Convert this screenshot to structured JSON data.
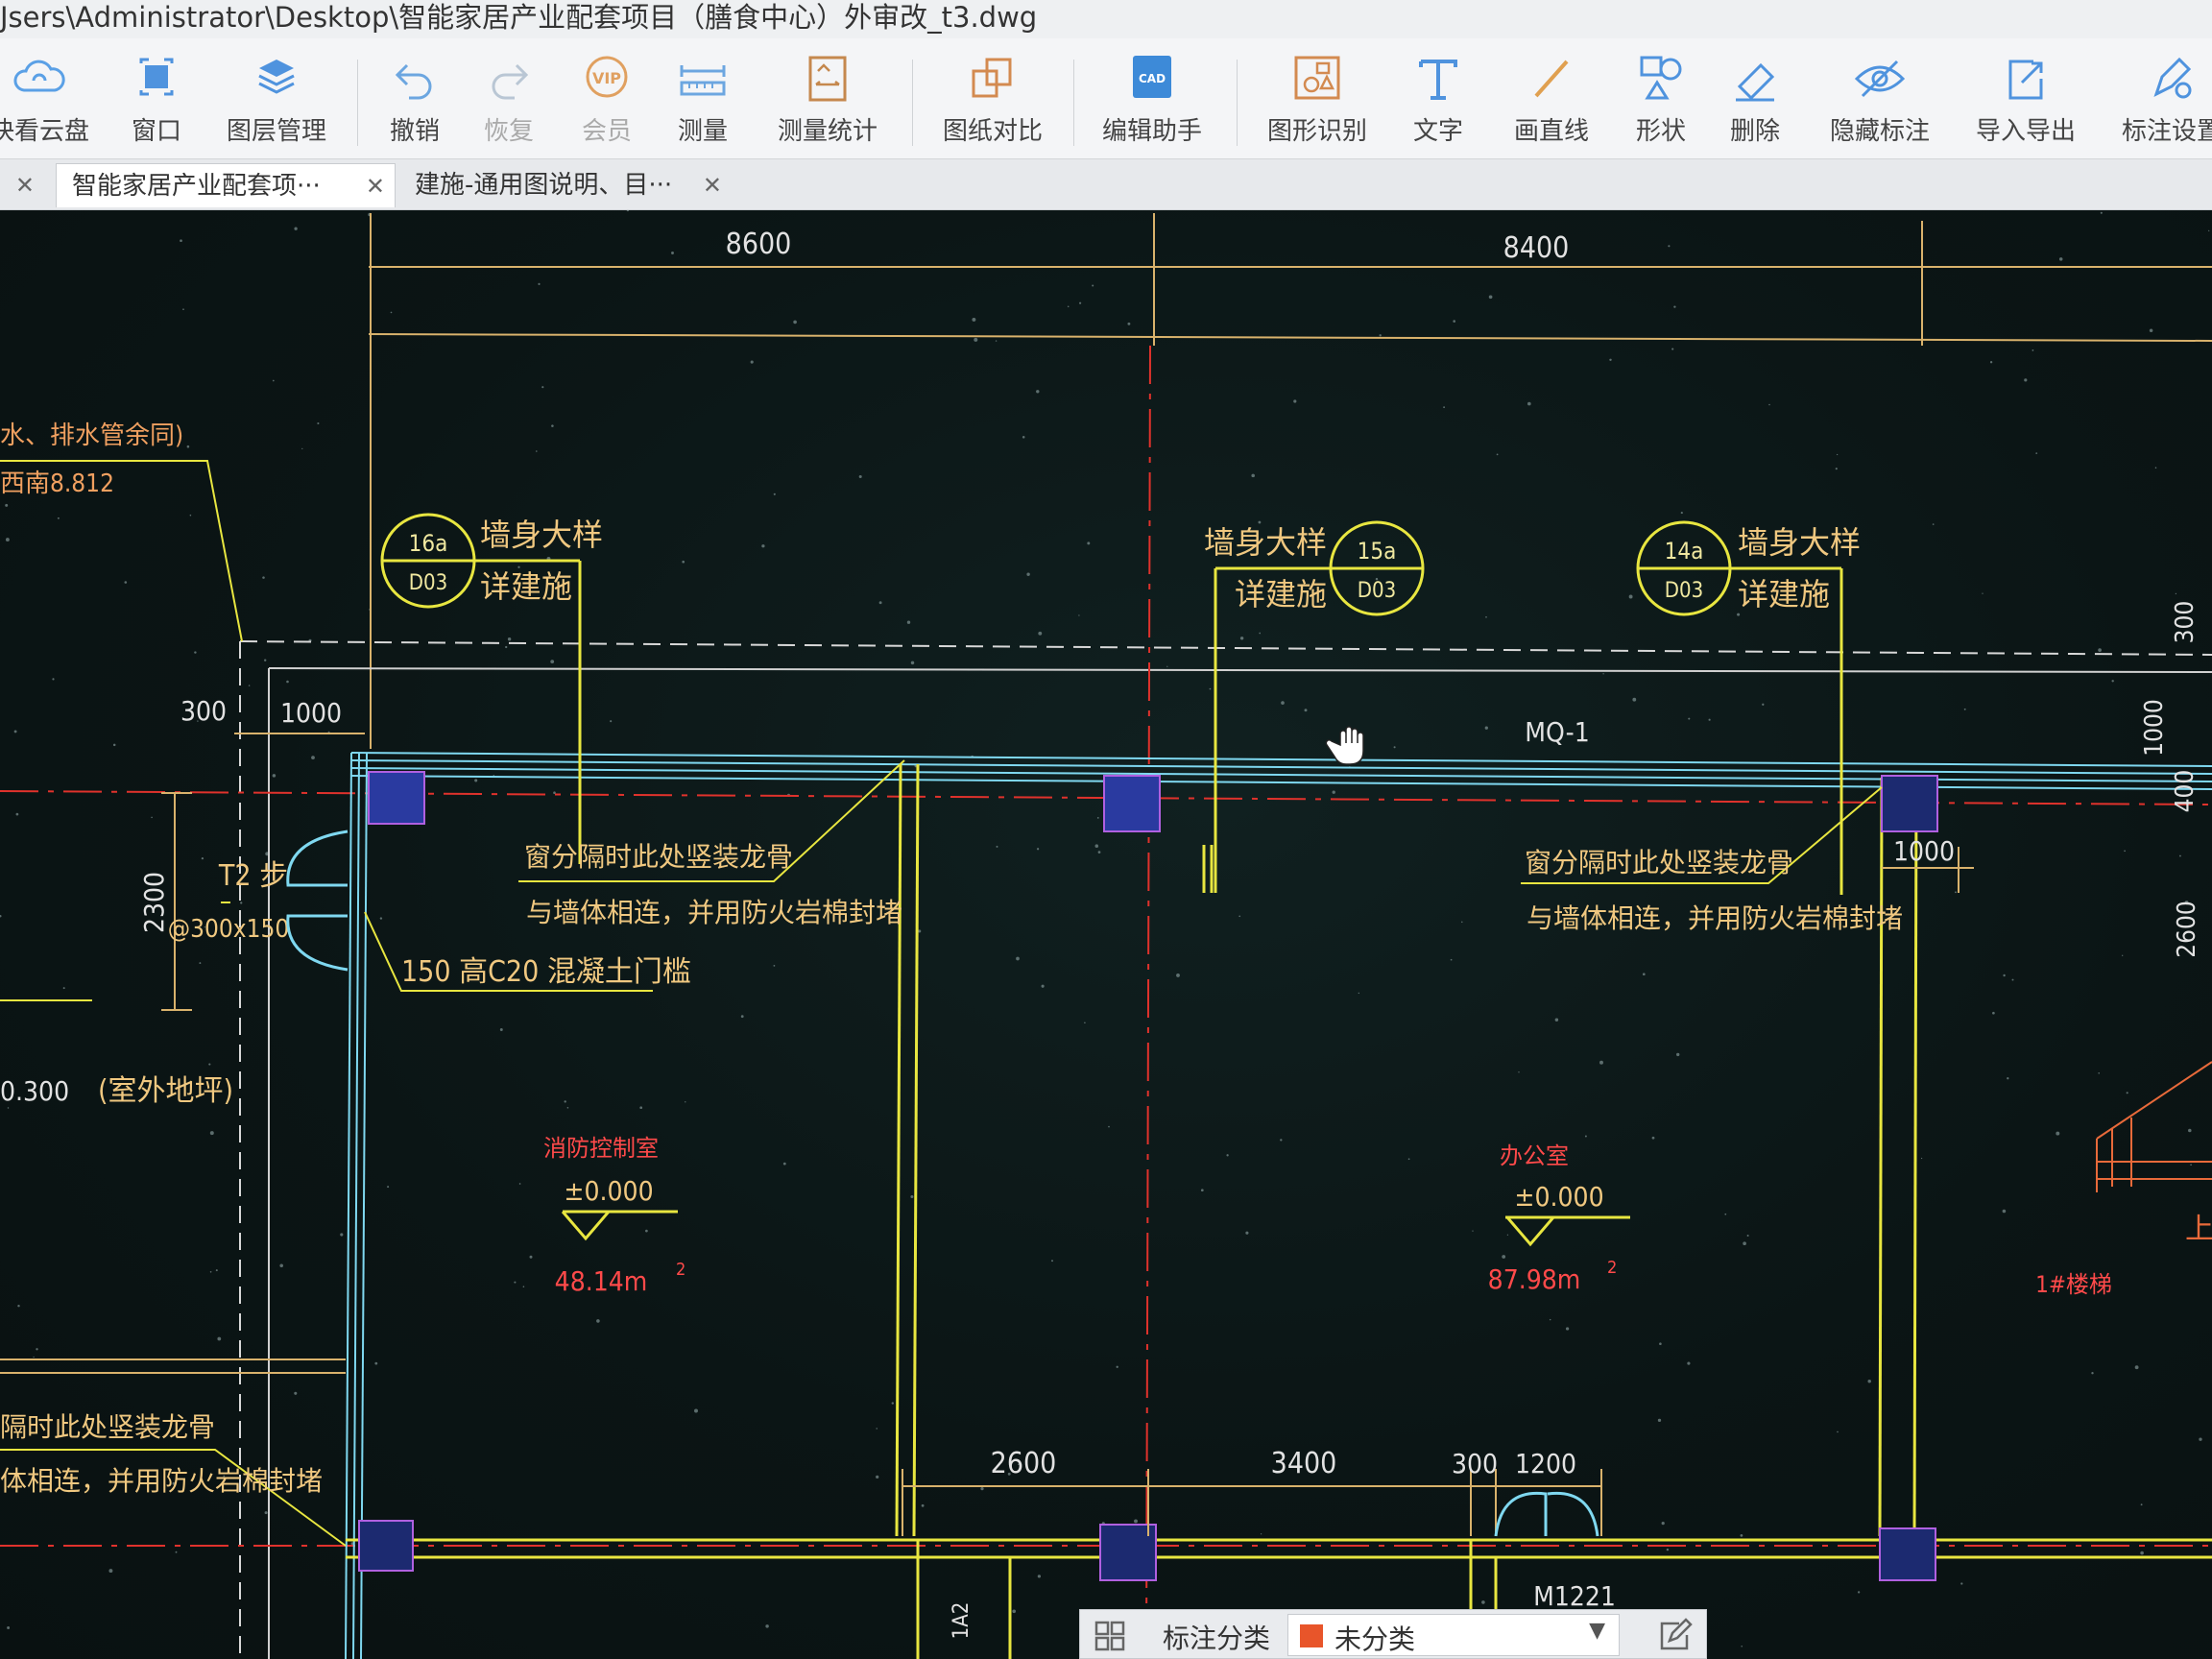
{
  "window": {
    "title": "Jsers\\Administrator\\Desktop\\智能家居产业配套项目（膳食中心）外审改_t3.dwg"
  },
  "toolbar": {
    "items": [
      {
        "label": "快看云盘",
        "icon": "cloud-icon"
      },
      {
        "label": "窗口",
        "icon": "window-icon"
      },
      {
        "label": "图层管理",
        "icon": "layers-icon"
      },
      {
        "label": "撤销",
        "icon": "undo-icon"
      },
      {
        "label": "恢复",
        "icon": "redo-icon"
      },
      {
        "label": "会员",
        "icon": "vip-icon"
      },
      {
        "label": "测量",
        "icon": "ruler-icon"
      },
      {
        "label": "测量统计",
        "icon": "measure-stats-icon"
      },
      {
        "label": "图纸对比",
        "icon": "compare-icon"
      },
      {
        "label": "编辑助手",
        "icon": "cad-edit-icon"
      },
      {
        "label": "图形识别",
        "icon": "shape-recognition-icon"
      },
      {
        "label": "文字",
        "icon": "text-icon"
      },
      {
        "label": "画直线",
        "icon": "line-icon"
      },
      {
        "label": "形状",
        "icon": "shapes-icon"
      },
      {
        "label": "删除",
        "icon": "eraser-icon"
      },
      {
        "label": "隐藏标注",
        "icon": "eye-hide-icon"
      },
      {
        "label": "导入导出",
        "icon": "import-export-icon"
      },
      {
        "label": "标注设置",
        "icon": "annotation-settings-icon"
      }
    ]
  },
  "tabs": [
    {
      "label": "智能家居产业配套项···",
      "active": true
    },
    {
      "label": "建施-通用图说明、目···",
      "active": false
    }
  ],
  "drawing": {
    "dims_top": [
      "8600",
      "8400"
    ],
    "dims_left": [
      "300",
      "1000",
      "2300"
    ],
    "dims_right": [
      "300",
      "1000",
      "400",
      "2600"
    ],
    "dims_bottom": [
      "2600",
      "3400",
      "300",
      "1200"
    ],
    "dim_1000_right": "1000",
    "callouts": [
      {
        "top": "16a",
        "bottom": "D03",
        "line1": "墙身大样",
        "line2": "详建施"
      },
      {
        "top": "15a",
        "bottom": "D03",
        "line1": "墙身大样",
        "line2": "详建施"
      },
      {
        "top": "14a",
        "bottom": "D03",
        "line1": "墙身大样",
        "line2": "详建施"
      }
    ],
    "notes": {
      "left_top_1": "水、排水管余同)",
      "left_top_2": "西南8.812",
      "step": "T2 步",
      "step_spec": "@300x150",
      "sill": "150 高C20 混凝土门槛",
      "gap_note_1a": "窗分隔时此处竖装龙骨",
      "gap_note_1b": "与墙体相连，并用防火岩棉封堵",
      "gap_note_2a": "窗分隔时此处竖装龙骨",
      "gap_note_2b": "与墙体相连，并用防火岩棉封堵",
      "gap_note_3a": "隔时此处竖装龙骨",
      "gap_note_3b": "体相连，并用防火岩棉封堵",
      "outdoor": "0.300",
      "outdoor_label": "(室外地坪)",
      "window_tag": "MQ-1",
      "door_tag": "M1221",
      "col_tag": "1A2",
      "stair_label": "上",
      "stair_note": "1#楼梯"
    },
    "rooms": [
      {
        "name": "消防控制室",
        "level": "±0.000",
        "area": "48.14m",
        "sup": "2"
      },
      {
        "name": "办公室",
        "level": "±0.000",
        "area": "87.98m",
        "sup": "2"
      }
    ]
  },
  "tagbar": {
    "label": "标注分类",
    "selected": "未分类",
    "swatch_color": "#e8552a"
  }
}
